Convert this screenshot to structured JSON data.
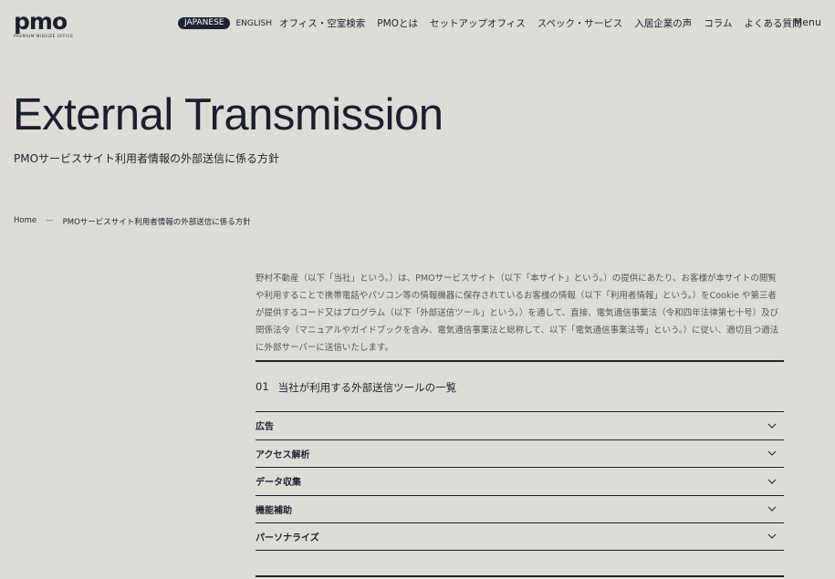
{
  "header": {
    "logo_mark": "pmo",
    "logo_sub": "PREMIUM MIDSIZE OFFICE",
    "lang_active": "JAPANESE",
    "lang_other": "ENGLISH",
    "nav": [
      "オフィス・空室検索",
      "PMOとは",
      "セットアップオフィス",
      "スペック・サービス",
      "入居企業の声",
      "コラム",
      "よくある質問"
    ],
    "menu_label": "Menu"
  },
  "hero": {
    "title": "External Transmission",
    "subtitle": "PMOサービスサイト利用者情報の外部送信に係る方針"
  },
  "breadcrumb": {
    "home": "Home",
    "separator": "—",
    "current": "PMOサービスサイト利用者情報の外部送信に係る方針"
  },
  "intro": "野村不動産（以下「当社」という。）は、PMOサービスサイト（以下「本サイト」という。）の提供にあたり、お客様が本サイトの閲覧や利用することで携帯電話やパソコン等の情報機器に保存されているお客様の情報（以下「利用者情報」という。）をCookie や第三者が提供するコード又はプログラム（以下「外部送信ツール」という。）を通して、直接、電気通信事業法（令和四年法律第七十号）及び関係法令（マニュアルやガイドブックを含み、電気通信事業法と総称して、以下「電気通信事業法等」という。）に従い、適切且つ適法に外部サーバーに送信いたします。",
  "section": {
    "number": "01",
    "title": "当社が利用する外部送信ツールの一覧",
    "items": [
      "広告",
      "アクセス解析",
      "データ収集",
      "機能補助",
      "パーソナライズ"
    ],
    "chevron_icon": "chevron-down-icon"
  }
}
